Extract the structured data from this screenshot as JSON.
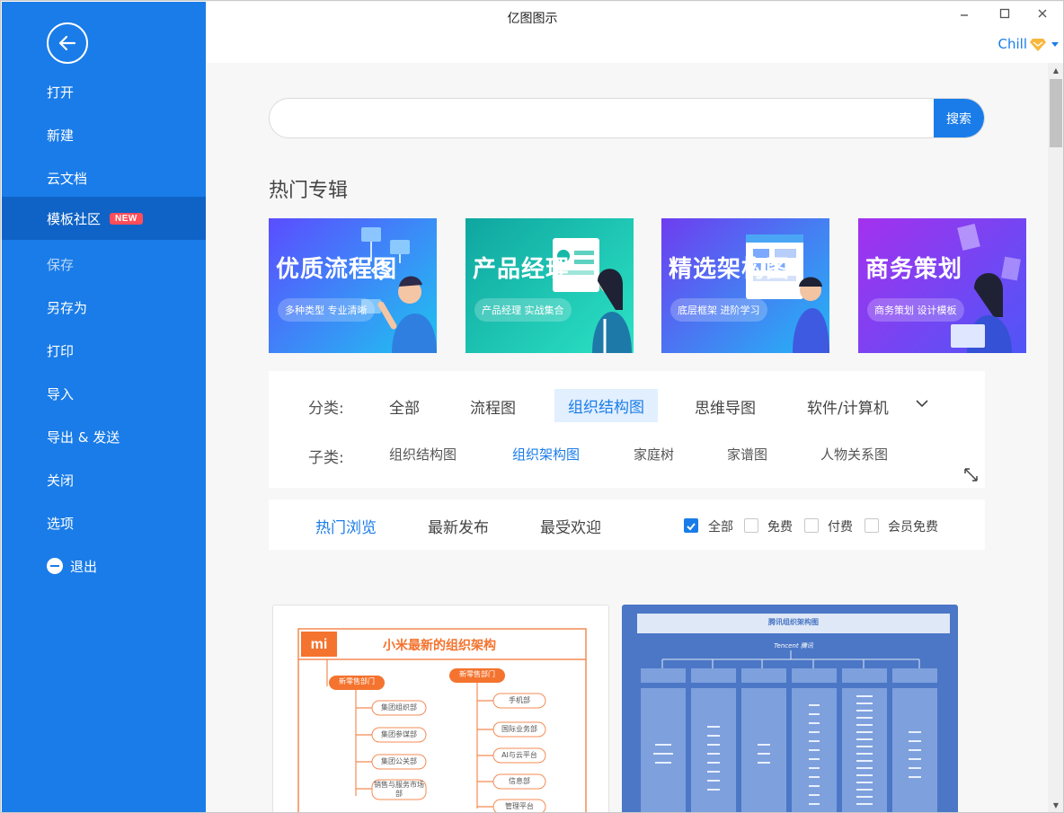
{
  "app": {
    "title": "亿图图示",
    "window_controls": [
      "minimize",
      "maximize",
      "close"
    ]
  },
  "user": {
    "name": "Chill",
    "badge_icon": "vip-diamond-icon"
  },
  "sidebar": {
    "back_icon": "arrow-left-icon",
    "items": [
      {
        "id": "open",
        "label": "打开",
        "state": "normal"
      },
      {
        "id": "new",
        "label": "新建",
        "state": "normal"
      },
      {
        "id": "cloud",
        "label": "云文档",
        "state": "normal"
      },
      {
        "id": "templates",
        "label": "模板社区",
        "state": "active",
        "badge": "NEW"
      },
      {
        "id": "save",
        "label": "保存",
        "state": "disabled"
      },
      {
        "id": "saveas",
        "label": "另存为",
        "state": "normal"
      },
      {
        "id": "print",
        "label": "打印",
        "state": "normal"
      },
      {
        "id": "import",
        "label": "导入",
        "state": "normal"
      },
      {
        "id": "export",
        "label": "导出 & 发送",
        "state": "normal"
      },
      {
        "id": "close",
        "label": "关闭",
        "state": "normal"
      },
      {
        "id": "options",
        "label": "选项",
        "state": "normal"
      },
      {
        "id": "exit",
        "label": "退出",
        "state": "normal",
        "icon": "minus-circle-icon"
      }
    ]
  },
  "search": {
    "value": "",
    "placeholder": "",
    "button_label": "搜索"
  },
  "featured": {
    "title": "热门专辑",
    "banners": [
      {
        "title": "优质流程图",
        "subtitle": "多种类型 专业清晰",
        "colors": [
          "#5b4dff",
          "#1fc3f0"
        ]
      },
      {
        "title": "产品经理",
        "subtitle": "产品经理 实战集合",
        "colors": [
          "#12b5a6",
          "#2be0c0"
        ]
      },
      {
        "title": "精选架构图",
        "subtitle": "底层框架 进阶学习",
        "colors": [
          "#6e3df0",
          "#22b7f5"
        ]
      },
      {
        "title": "商务策划",
        "subtitle": "商务策划 设计模板",
        "colors": [
          "#a431ee",
          "#4f56f7"
        ]
      }
    ]
  },
  "filters": {
    "category_label": "分类:",
    "categories": [
      {
        "label": "全部",
        "selected": false
      },
      {
        "label": "流程图",
        "selected": false
      },
      {
        "label": "组织结构图",
        "selected": true
      },
      {
        "label": "思维导图",
        "selected": false
      },
      {
        "label": "软件/计算机",
        "selected": false
      }
    ],
    "subcategory_label": "子类:",
    "subcategories": [
      {
        "label": "组织结构图",
        "selected": false
      },
      {
        "label": "组织架构图",
        "selected": true
      },
      {
        "label": "家庭树",
        "selected": false
      },
      {
        "label": "家谱图",
        "selected": false
      },
      {
        "label": "人物关系图",
        "selected": false
      }
    ]
  },
  "sort": {
    "tabs": [
      {
        "label": "热门浏览",
        "selected": true
      },
      {
        "label": "最新发布",
        "selected": false
      },
      {
        "label": "最受欢迎",
        "selected": false
      }
    ],
    "price_filters": [
      {
        "label": "全部",
        "checked": true
      },
      {
        "label": "免费",
        "checked": false
      },
      {
        "label": "付费",
        "checked": false
      },
      {
        "label": "会员免费",
        "checked": false
      }
    ]
  },
  "templates": [
    {
      "title": "小米最新的组织架构",
      "brand": "mi",
      "left_head": "新零售部门",
      "left_items": [
        "集团组织部",
        "集团参谋部",
        "集团公关部",
        "销售与服务市场部"
      ],
      "right_head": "新零售部门",
      "right_items": [
        "手机部",
        "国际业务部",
        "AI与云平台",
        "信息部",
        "管理平台"
      ]
    },
    {
      "title": "腾讯组织架构图",
      "subtitle": "Tencent 腾讯"
    }
  ],
  "colors": {
    "accent": "#1a7ce8",
    "sidebar_active": "#0f63c6",
    "badge": "#ff4d5a"
  }
}
